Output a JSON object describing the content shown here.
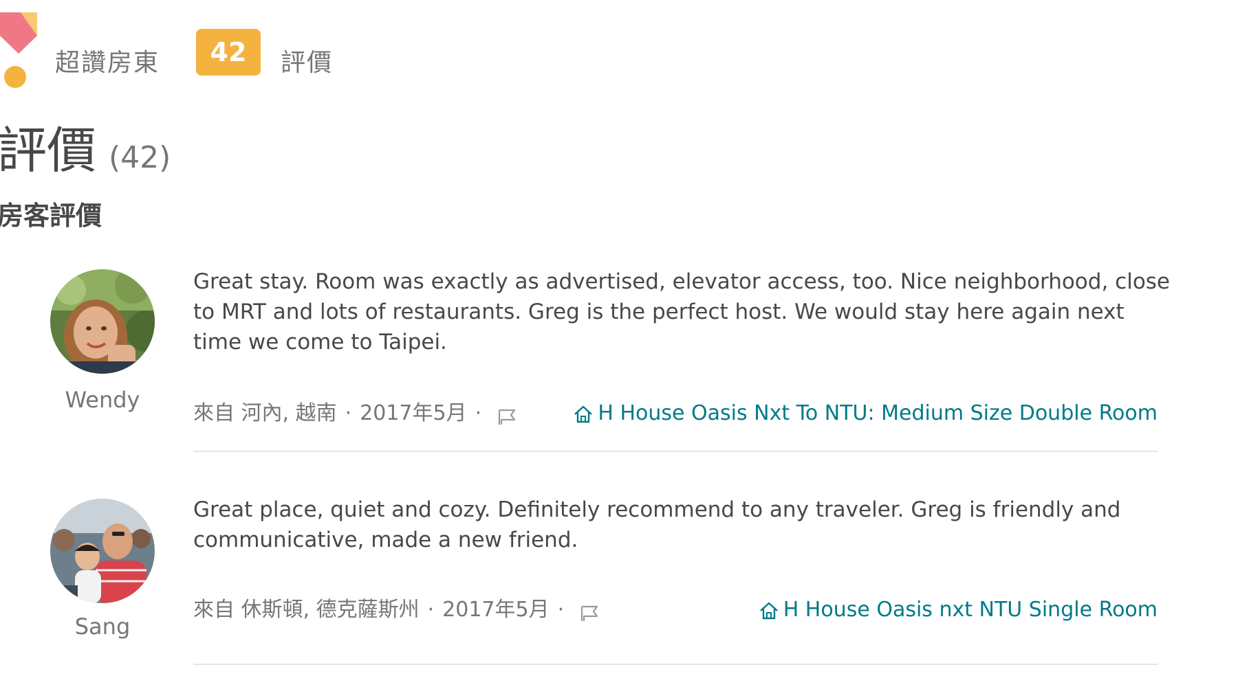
{
  "host": {
    "superhost_label": "超讚房東",
    "review_count_badge": "42",
    "reviews_label": "評價"
  },
  "section": {
    "title": "評價",
    "count": "(42)",
    "guest_reviews_heading": "房客評價"
  },
  "reviews": [
    {
      "name": "Wendy",
      "text": "Great stay. Room was exactly as advertised, elevator access, too. Nice neighborhood, close to MRT and lots of restaurants. Greg is the perfect host. We would stay here again next time we come to Taipei.",
      "from": "來自 河內, 越南",
      "date": "2017年5月",
      "listing": "H House Oasis Nxt To NTU: Medium Size Double Room"
    },
    {
      "name": "Sang",
      "text": "Great place, quiet and cozy. Definitely recommend to any traveler. Greg is friendly and communicative, made a new friend.",
      "from": "來自 休斯頓, 德克薩斯州",
      "date": "2017年5月",
      "listing": "H House Oasis nxt NTU Single Room"
    }
  ],
  "meta_separator": "·",
  "colors": {
    "badge": "#f4b33f",
    "link": "#007a87",
    "text": "#484848",
    "muted": "#767676",
    "logo_pink": "#f07886",
    "logo_gold": "#f4b33f"
  },
  "icons": {
    "superhost_badge": "superhost-medal-icon",
    "flag": "flag-icon",
    "listing": "home-icon"
  }
}
